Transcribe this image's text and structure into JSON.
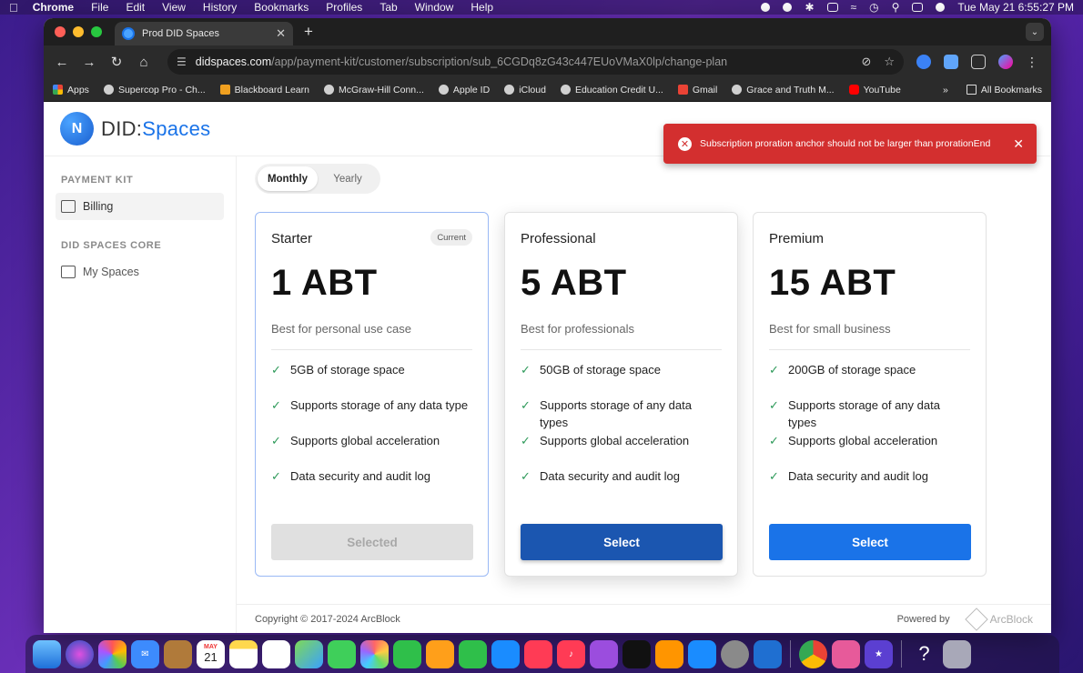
{
  "menubar": {
    "app": "Chrome",
    "items": [
      "File",
      "Edit",
      "View",
      "History",
      "Bookmarks",
      "Profiles",
      "Tab",
      "Window",
      "Help"
    ],
    "clock": "Tue May 21  6:55:27 PM"
  },
  "browser": {
    "tab_title": "Prod DID Spaces",
    "url_domain": "didspaces.com",
    "url_path": "/app/payment-kit/customer/subscription/sub_6CGDq8zG43c447EUoVMaX0lp/change-plan",
    "bookmarks": [
      "Apps",
      "Supercop Pro - Ch...",
      "Blackboard Learn",
      "McGraw-Hill Conn...",
      "Apple ID",
      "iCloud",
      "Education Credit U...",
      "Gmail",
      "Grace and Truth M...",
      "YouTube"
    ],
    "all_bookmarks": "All Bookmarks",
    "more": "»"
  },
  "app": {
    "logo_prefix": "DID",
    "logo_sep": ":",
    "logo_suffix": "Spaces",
    "sidebar": {
      "section1": "PAYMENT KIT",
      "billing": "Billing",
      "section2": "DID SPACES CORE",
      "my_spaces": "My Spaces"
    },
    "billing_toggle": {
      "monthly": "Monthly",
      "yearly": "Yearly"
    },
    "plans": [
      {
        "name": "Starter",
        "badge": "Current",
        "price": "1 ABT",
        "desc": "Best for personal use case",
        "features": [
          "5GB of storage space",
          "Supports storage of any data type",
          "Supports global acceleration",
          "Data security and audit log"
        ],
        "cta": "Selected"
      },
      {
        "name": "Professional",
        "price": "5 ABT",
        "desc": "Best for professionals",
        "features": [
          "50GB of storage space",
          "Supports storage of any data types",
          "Supports global acceleration",
          "Data security and audit log"
        ],
        "cta": "Select"
      },
      {
        "name": "Premium",
        "price": "15 ABT",
        "desc": "Best for small business",
        "features": [
          "200GB of storage space",
          "Supports storage of any data types",
          "Supports global acceleration",
          "Data security and audit log"
        ],
        "cta": "Select"
      }
    ],
    "footer": {
      "copyright": "Copyright © 2017-2024  ArcBlock",
      "powered_by": "Powered by",
      "brand": "ArcBlock"
    }
  },
  "toast": {
    "message": "Subscription proration anchor should not be larger than prorationEnd"
  },
  "dock": {
    "calendar_month": "MAY",
    "calendar_day": "21"
  },
  "colors": {
    "accent": "#1a73e8",
    "error": "#d32f2f",
    "check": "#2e9a5a"
  }
}
